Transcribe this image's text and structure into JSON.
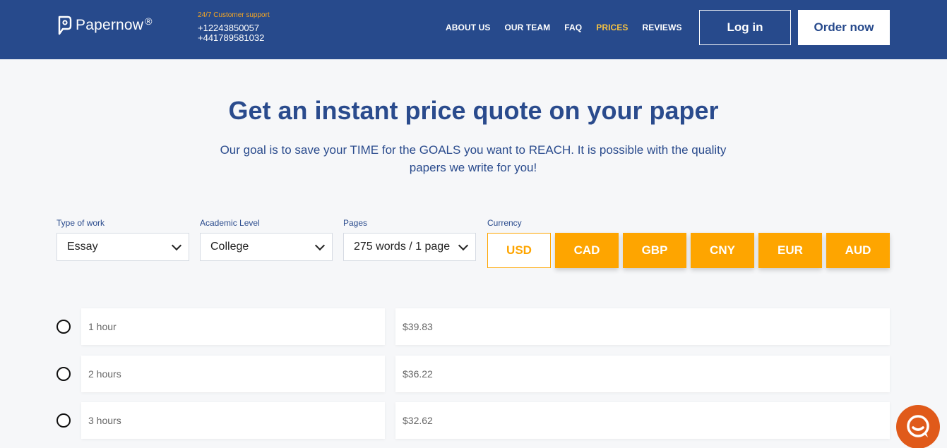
{
  "brand": {
    "name": "Papernow",
    "reg": "®"
  },
  "support": {
    "label": "24/7 Customer support",
    "phones": [
      "+12243850057",
      "+441789581032"
    ]
  },
  "nav": {
    "items": [
      {
        "label": "ABOUT US"
      },
      {
        "label": "OUR TEAM"
      },
      {
        "label": "FAQ"
      },
      {
        "label": "PRICES",
        "active": true
      },
      {
        "label": "REVIEWS"
      }
    ]
  },
  "header": {
    "login_label": "Log in",
    "order_label": "Order now"
  },
  "hero": {
    "title": "Get an instant price quote on your paper",
    "subtitle": "Our goal is to save your TIME for the GOALS you want to REACH. It is possible with the quality papers we write for you!"
  },
  "form": {
    "type_of_work": {
      "label": "Type of work",
      "value": "Essay"
    },
    "academic_level": {
      "label": "Academic Level",
      "value": "College"
    },
    "pages": {
      "label": "Pages",
      "value": "275 words / 1 page"
    },
    "currency": {
      "label": "Currency",
      "options": [
        "USD",
        "CAD",
        "GBP",
        "CNY",
        "EUR",
        "AUD"
      ],
      "selected": "USD"
    }
  },
  "prices": [
    {
      "deadline": "1 hour",
      "price": "$39.83"
    },
    {
      "deadline": "2 hours",
      "price": "$36.22"
    },
    {
      "deadline": "3 hours",
      "price": "$32.62"
    }
  ],
  "colors": {
    "header_bg": "#274a8c",
    "accent": "#fea500",
    "nav_active": "#f5c242",
    "chat": "#e05a1a"
  },
  "icons": {
    "logo": "papernow-logo-icon",
    "chat": "chat-bubble-icon",
    "dropdown": "chevron-down-icon"
  }
}
